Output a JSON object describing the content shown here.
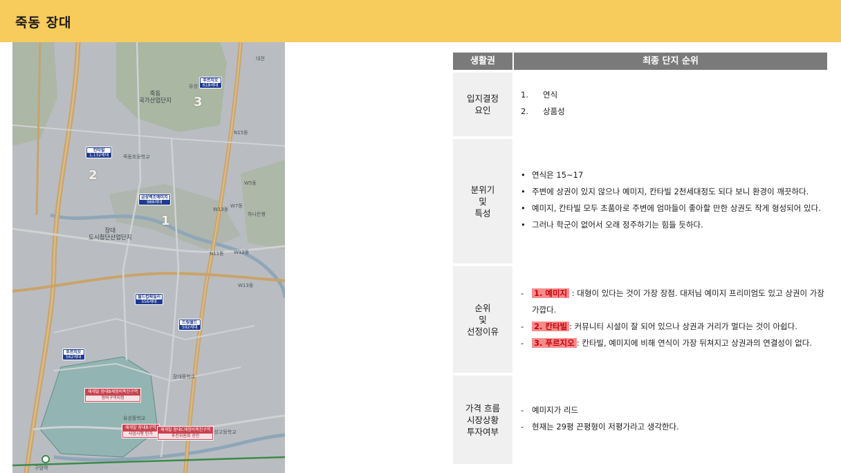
{
  "header": {
    "title": "죽동 장대"
  },
  "map": {
    "labels": {
      "jukdong": "죽동\n국가산업단지",
      "jangdae": "장대\n도시첨단산업단지",
      "gunri": "유성구",
      "n15": "N15동",
      "w5": "W5동",
      "w7": "W7동",
      "w13": "W13동",
      "n11": "N11동",
      "w12": "W12동",
      "w13b": "W13동",
      "school1": "죽동초등학교",
      "school2": "장대중학교",
      "school3": "유성중학교",
      "school4": "유성고등학교",
      "station": "구암역",
      "hanbat": "하나은행",
      "daejeon": "대전"
    },
    "pins": [
      {
        "title": "푸르지오",
        "sub": "618세대"
      },
      {
        "title": "칸타빌",
        "sub": "1,132세대"
      },
      {
        "title": "금성백조예미지",
        "sub": "988세대"
      },
      {
        "title": "월드컵패밀리",
        "sub": "556세대"
      },
      {
        "title": "드림월드",
        "sub": "592세대"
      },
      {
        "title": "푸르지오",
        "sub": "562세대"
      }
    ],
    "redboxes": [
      {
        "title": "재개발 장대B재정비촉진구역",
        "sub": "정비구역지정"
      },
      {
        "title": "재개발 장대B구역",
        "sub": "사업시행 인가"
      },
      {
        "title": "재개발 장대C재정비촉진구역",
        "sub": "추진위원회 승인"
      }
    ],
    "ranks": [
      "1",
      "2",
      "3"
    ]
  },
  "table": {
    "header_left": "생활권",
    "header_right": "최종 단지 순위",
    "rows": {
      "factors": {
        "label": "입지결정\n요인",
        "items": [
          {
            "num": "1.",
            "text": "연식"
          },
          {
            "num": "2.",
            "text": "상품성"
          }
        ]
      },
      "character": {
        "label": "분위기\n및\n특성",
        "bullet": "•",
        "items": [
          "연식은 15~17",
          "주변에 상권이 있지 않으나 예미지, 칸타빌 2천세대정도 되다 보니 환경이 깨끗하다.",
          "예미지, 칸타빌 모두 초품아로 주변에 엄마들이 좋아할 만한 상권도 작게 형성되어 있다.",
          "그러나 학군이 없어서 오래 정주하기는 힘들 듯하다."
        ]
      },
      "ranking": {
        "label": "순위\n및\n선정이유",
        "dash": "-",
        "items": [
          {
            "tag": "1. 예미지",
            "text": " : 대형이 있다는 것이 가장 장점. 대저님 예미지 프리미엄도 있고 상권이 가장 가깝다."
          },
          {
            "tag": "2. 칸타빌",
            "text": ": 커뮤니티 시설이 잘 되어 있으나 상권과 거리가 멀다는 것이 아쉽다."
          },
          {
            "tag": "3. 푸르지오",
            "text": ":  칸타빌, 예미지에 비해 연식이 가장 뒤쳐지고 상권과의 연결성이 없다."
          }
        ]
      },
      "price": {
        "label": "가격 흐름\n시장상황\n투자여부",
        "dash": "-",
        "items": [
          "예미지가 리드",
          "현재는 29평 끈평형이 저평가라고 생각한다."
        ]
      }
    }
  },
  "colors": {
    "header_bg": "#f7cb5c",
    "table_header_bg": "#7a7a7a",
    "label_bg": "#f0f0f0",
    "highlight_bg": "#f98b8b",
    "highlight_text": "#c2000a",
    "pin_bg": "#1f3a8f",
    "redbox_bg": "#c94350"
  }
}
